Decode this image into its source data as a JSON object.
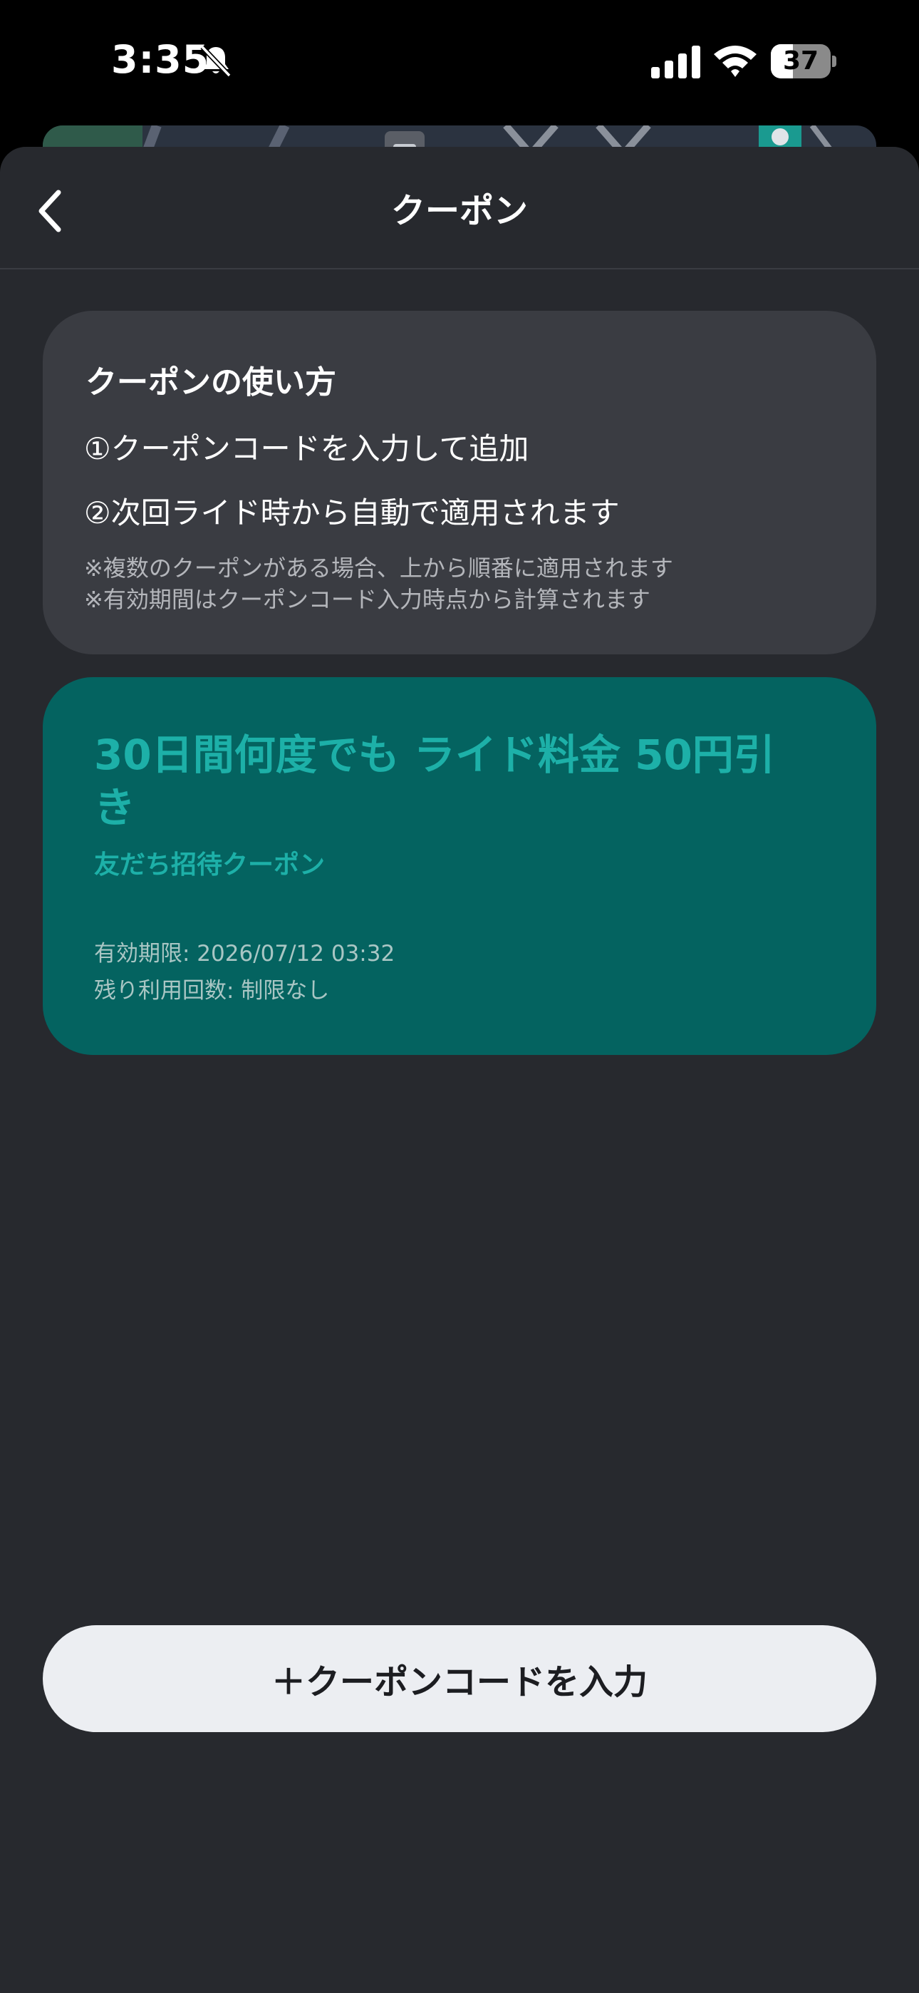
{
  "status_bar": {
    "time": "3:35",
    "battery_level": "37",
    "battery_fraction": 0.37,
    "icons": [
      "bell-slash-icon",
      "cellular-signal-icon",
      "wifi-icon",
      "battery-icon"
    ]
  },
  "header": {
    "title": "クーポン",
    "back_icon": "chevron-left-icon"
  },
  "howto": {
    "title": "クーポンの使い方",
    "steps": [
      "①クーポンコードを入力して追加",
      "②次回ライド時から自動で適用されます"
    ],
    "notes": [
      "※複数のクーポンがある場合、上から順番に適用されます",
      "※有効期間はクーポンコード入力時点から計算されます"
    ]
  },
  "coupon": {
    "title": "30日間何度でも ライド料金 50円引き",
    "subtitle": "友だち招待クーポン",
    "expiry": "有効期限: 2026/07/12 03:32",
    "remaining": "残り利用回数: 制限なし"
  },
  "footer": {
    "enter_code_label": "＋クーポンコードを入力"
  },
  "colors": {
    "sheet_background": "#27292e",
    "card_background": "#3a3c42",
    "coupon_background": "#046360",
    "coupon_accent": "#1db0a8",
    "button_background": "#eceef2"
  }
}
